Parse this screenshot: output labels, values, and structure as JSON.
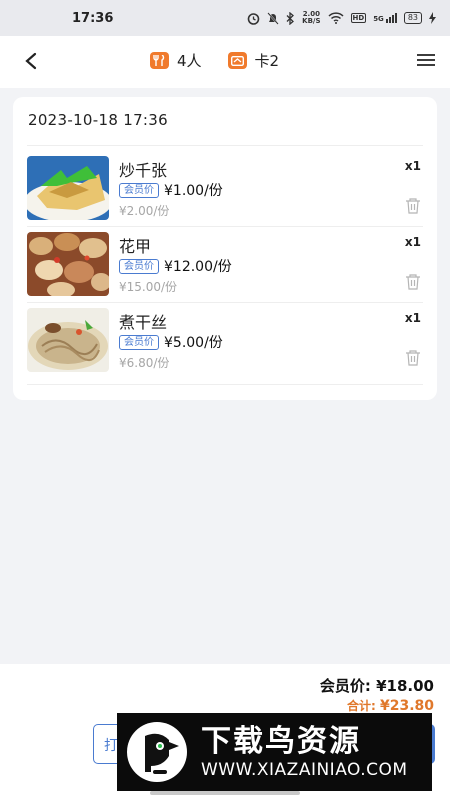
{
  "status_bar": {
    "time": "17:36",
    "net_speed_value": "2.00",
    "net_speed_unit": "KB/S",
    "hd_label": "HD",
    "network_label": "5G",
    "battery": "83"
  },
  "header": {
    "guests_label": "4人",
    "card_label": "卡2"
  },
  "order": {
    "datetime": "2023-10-18 17:36",
    "items": [
      {
        "name": "炒千张",
        "member_tag": "会员价",
        "member_price": "¥1.00/份",
        "original_price": "¥2.00/份",
        "qty": "x1"
      },
      {
        "name": "花甲",
        "member_tag": "会员价",
        "member_price": "¥12.00/份",
        "original_price": "¥15.00/份",
        "qty": "x1"
      },
      {
        "name": "煮干丝",
        "member_tag": "会员价",
        "member_price": "¥5.00/份",
        "original_price": "¥6.80/份",
        "qty": "x1"
      }
    ]
  },
  "summary": {
    "member_total_label": "会员价:",
    "member_total": "¥18.00",
    "total_label": "合计:",
    "total": "¥23.80"
  },
  "actions": {
    "print_label_partial": "打"
  },
  "watermark": {
    "title": "下载鸟资源",
    "url": "WWW.XIAZAINIAO.COM"
  },
  "colors": {
    "accent_orange": "#f07a2c",
    "tag_blue": "#4a7bd0",
    "total_orange": "#e0782b"
  }
}
